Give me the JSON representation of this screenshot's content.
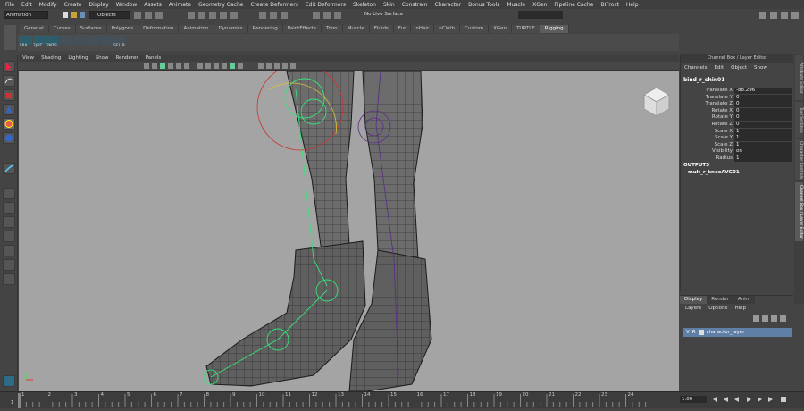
{
  "menubar": [
    "File",
    "Edit",
    "Modify",
    "Create",
    "Display",
    "Window",
    "Assets",
    "Animate",
    "Geometry Cache",
    "Create Deformers",
    "Edit Deformers",
    "Skeleton",
    "Skin",
    "Constrain",
    "Character",
    "Bonus Tools",
    "Muscle",
    "XGen",
    "Pipeline Cache",
    "BIFrost",
    "Help"
  ],
  "status": {
    "mode": "Animation",
    "objects_label": "Objects",
    "live_surface": "No Live Surface"
  },
  "shelf_tabs": [
    "General",
    "Curves",
    "Surfaces",
    "Polygons",
    "Deformation",
    "Animation",
    "Dynamics",
    "Rendering",
    "PaintEffects",
    "Toon",
    "Muscle",
    "Fluids",
    "Fur",
    "nHair",
    "nCloth",
    "Custom",
    "XGen",
    "TURTLE",
    "Rigging"
  ],
  "shelf_active": "Rigging",
  "shelf_buttons": [
    "LRA",
    "2JNT",
    "3NTS",
    "",
    "",
    "",
    "",
    "SEL B"
  ],
  "viewport_menu": [
    "View",
    "Shading",
    "Lighting",
    "Show",
    "Renderer",
    "Panels"
  ],
  "channel_box": {
    "header": "Channel Box / Layer Editor",
    "menu": [
      "Channels",
      "Edit",
      "Object",
      "Show"
    ],
    "node": "bind_r_shin01",
    "attributes": [
      {
        "name": "Translate X",
        "value": "-88.296"
      },
      {
        "name": "Translate Y",
        "value": "0"
      },
      {
        "name": "Translate Z",
        "value": "0"
      },
      {
        "name": "Rotate X",
        "value": "0"
      },
      {
        "name": "Rotate Y",
        "value": "0"
      },
      {
        "name": "Rotate Z",
        "value": "0"
      },
      {
        "name": "Scale X",
        "value": "1"
      },
      {
        "name": "Scale Y",
        "value": "1"
      },
      {
        "name": "Scale Z",
        "value": "1"
      },
      {
        "name": "Visibility",
        "value": "on"
      },
      {
        "name": "Radius",
        "value": "1"
      }
    ],
    "outputs_label": "OUTPUTS",
    "outputs_node": "mult_r_kneeAVG01"
  },
  "side_tabs": [
    "Attribute Editor",
    "Tool Settings",
    "Character Controls",
    "Channel Box / Layer Editor"
  ],
  "layer_editor": {
    "tabs": [
      "Display",
      "Render",
      "Anim"
    ],
    "menu": [
      "Layers",
      "Options",
      "Help"
    ],
    "layer": {
      "v": "V",
      "p": "R",
      "name": "character_layer"
    }
  },
  "timeline": {
    "ticks": [
      "1",
      "2",
      "3",
      "4",
      "5",
      "6",
      "7",
      "8",
      "9",
      "10",
      "11",
      "12",
      "13",
      "14",
      "15",
      "16",
      "17",
      "18",
      "19",
      "20",
      "21",
      "22",
      "23",
      "24"
    ],
    "current_time": "1.00",
    "frame_left": "1"
  },
  "colors": {
    "viewport_bg": "#a4a4a4",
    "joint_green": "#39e07a",
    "joint_purple": "#6a2f9a",
    "selected_layer": "#5f7fa6"
  }
}
